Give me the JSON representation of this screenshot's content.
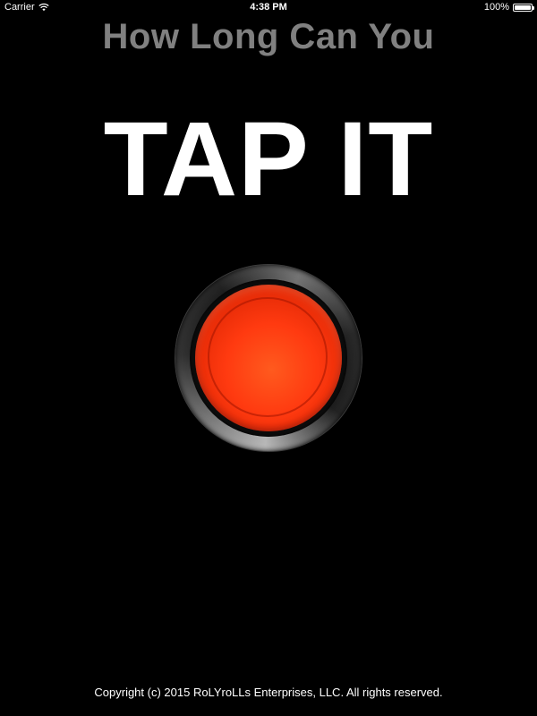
{
  "status_bar": {
    "carrier": "Carrier",
    "wifi_icon": "wifi-icon",
    "time": "4:38 PM",
    "battery_percent": "100%",
    "battery_level": 1.0,
    "battery_icon": "battery-icon"
  },
  "main": {
    "subtitle": "How Long Can You",
    "headline": "TAP IT",
    "button": {
      "icon": "big-red-button",
      "color": "#ff3a10"
    }
  },
  "footer": {
    "copyright": "Copyright (c) 2015 RoLYroLLs Enterprises, LLC. All rights reserved."
  },
  "colors": {
    "background": "#000000",
    "subtitle": "#808080",
    "headline": "#ffffff"
  }
}
